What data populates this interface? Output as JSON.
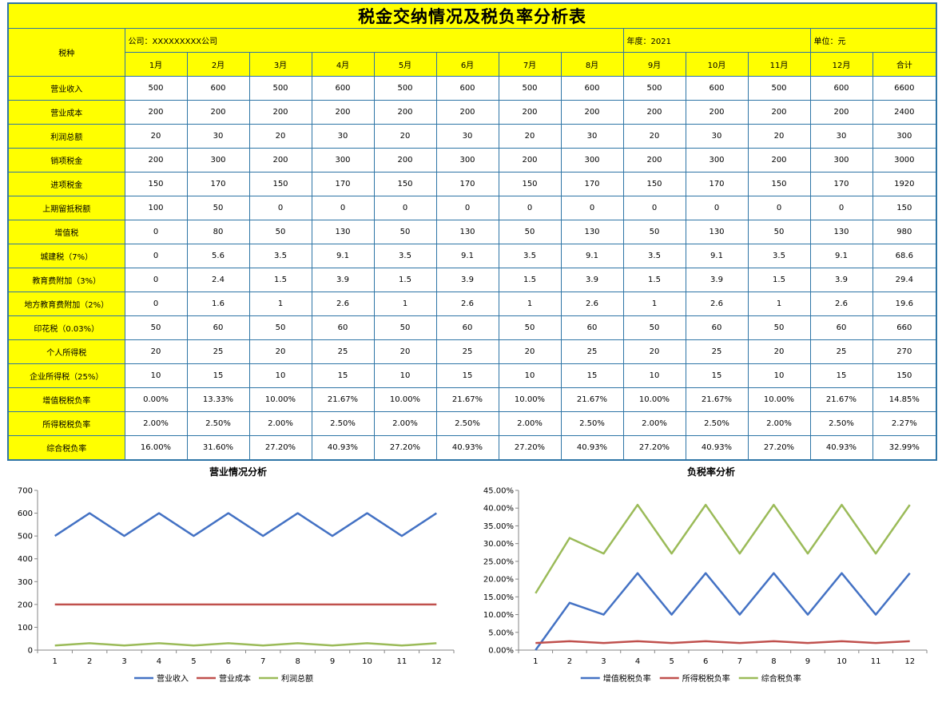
{
  "title": "税金交纳情况及税负率分析表",
  "header": {
    "tax_type": "税种",
    "company": "公司：XXXXXXXXX公司",
    "year": "年度：2021",
    "unit": "单位：元",
    "months": [
      "1月",
      "2月",
      "3月",
      "4月",
      "5月",
      "6月",
      "7月",
      "8月",
      "9月",
      "10月",
      "11月",
      "12月"
    ],
    "total": "合计"
  },
  "rows": [
    {
      "label": "营业收入",
      "values": [
        "500",
        "600",
        "500",
        "600",
        "500",
        "600",
        "500",
        "600",
        "500",
        "600",
        "500",
        "600",
        "6600"
      ]
    },
    {
      "label": "营业成本",
      "values": [
        "200",
        "200",
        "200",
        "200",
        "200",
        "200",
        "200",
        "200",
        "200",
        "200",
        "200",
        "200",
        "2400"
      ]
    },
    {
      "label": "利润总额",
      "values": [
        "20",
        "30",
        "20",
        "30",
        "20",
        "30",
        "20",
        "30",
        "20",
        "30",
        "20",
        "30",
        "300"
      ]
    },
    {
      "label": "销项税金",
      "values": [
        "200",
        "300",
        "200",
        "300",
        "200",
        "300",
        "200",
        "300",
        "200",
        "300",
        "200",
        "300",
        "3000"
      ]
    },
    {
      "label": "进项税金",
      "values": [
        "150",
        "170",
        "150",
        "170",
        "150",
        "170",
        "150",
        "170",
        "150",
        "170",
        "150",
        "170",
        "1920"
      ]
    },
    {
      "label": "上期留抵税额",
      "values": [
        "100",
        "50",
        "0",
        "0",
        "0",
        "0",
        "0",
        "0",
        "0",
        "0",
        "0",
        "0",
        "150"
      ]
    },
    {
      "label": "增值税",
      "values": [
        "0",
        "80",
        "50",
        "130",
        "50",
        "130",
        "50",
        "130",
        "50",
        "130",
        "50",
        "130",
        "980"
      ]
    },
    {
      "label": "城建税（7%）",
      "values": [
        "0",
        "5.6",
        "3.5",
        "9.1",
        "3.5",
        "9.1",
        "3.5",
        "9.1",
        "3.5",
        "9.1",
        "3.5",
        "9.1",
        "68.6"
      ]
    },
    {
      "label": "教育费附加（3%）",
      "values": [
        "0",
        "2.4",
        "1.5",
        "3.9",
        "1.5",
        "3.9",
        "1.5",
        "3.9",
        "1.5",
        "3.9",
        "1.5",
        "3.9",
        "29.4"
      ]
    },
    {
      "label": "地方教育费附加（2%）",
      "values": [
        "0",
        "1.6",
        "1",
        "2.6",
        "1",
        "2.6",
        "1",
        "2.6",
        "1",
        "2.6",
        "1",
        "2.6",
        "19.6"
      ]
    },
    {
      "label": "印花税（0.03%）",
      "values": [
        "50",
        "60",
        "50",
        "60",
        "50",
        "60",
        "50",
        "60",
        "50",
        "60",
        "50",
        "60",
        "660"
      ]
    },
    {
      "label": "个人所得税",
      "values": [
        "20",
        "25",
        "20",
        "25",
        "20",
        "25",
        "20",
        "25",
        "20",
        "25",
        "20",
        "25",
        "270"
      ]
    },
    {
      "label": "企业所得税（25%）",
      "values": [
        "10",
        "15",
        "10",
        "15",
        "10",
        "15",
        "10",
        "15",
        "10",
        "15",
        "10",
        "15",
        "150"
      ]
    },
    {
      "label": "增值税税负率",
      "values": [
        "0.00%",
        "13.33%",
        "10.00%",
        "21.67%",
        "10.00%",
        "21.67%",
        "10.00%",
        "21.67%",
        "10.00%",
        "21.67%",
        "10.00%",
        "21.67%",
        "14.85%"
      ]
    },
    {
      "label": "所得税税负率",
      "values": [
        "2.00%",
        "2.50%",
        "2.00%",
        "2.50%",
        "2.00%",
        "2.50%",
        "2.00%",
        "2.50%",
        "2.00%",
        "2.50%",
        "2.00%",
        "2.50%",
        "2.27%"
      ]
    },
    {
      "label": "综合税负率",
      "values": [
        "16.00%",
        "31.60%",
        "27.20%",
        "40.93%",
        "27.20%",
        "40.93%",
        "27.20%",
        "40.93%",
        "27.20%",
        "40.93%",
        "27.20%",
        "40.93%",
        "32.99%"
      ]
    }
  ],
  "chart_data": [
    {
      "type": "line",
      "title": "营业情况分析",
      "categories": [
        "1",
        "2",
        "3",
        "4",
        "5",
        "6",
        "7",
        "8",
        "9",
        "10",
        "11",
        "12"
      ],
      "ylim": [
        0,
        700
      ],
      "yticks": [
        "0",
        "100",
        "200",
        "300",
        "400",
        "500",
        "600",
        "700"
      ],
      "grid": false,
      "legend": "bottom",
      "series": [
        {
          "name": "营业收入",
          "color": "#4472c4",
          "values": [
            500,
            600,
            500,
            600,
            500,
            600,
            500,
            600,
            500,
            600,
            500,
            600
          ]
        },
        {
          "name": "营业成本",
          "color": "#c0504d",
          "values": [
            200,
            200,
            200,
            200,
            200,
            200,
            200,
            200,
            200,
            200,
            200,
            200
          ]
        },
        {
          "name": "利润总额",
          "color": "#9bbb59",
          "values": [
            20,
            30,
            20,
            30,
            20,
            30,
            20,
            30,
            20,
            30,
            20,
            30
          ]
        }
      ]
    },
    {
      "type": "line",
      "title": "负税率分析",
      "categories": [
        "1",
        "2",
        "3",
        "4",
        "5",
        "6",
        "7",
        "8",
        "9",
        "10",
        "11",
        "12"
      ],
      "ylim": [
        0,
        45
      ],
      "yticks": [
        "0.00%",
        "5.00%",
        "10.00%",
        "15.00%",
        "20.00%",
        "25.00%",
        "30.00%",
        "35.00%",
        "40.00%",
        "45.00%"
      ],
      "grid": false,
      "legend": "bottom",
      "series": [
        {
          "name": "增值税税负率",
          "color": "#4472c4",
          "values": [
            0,
            13.33,
            10,
            21.67,
            10,
            21.67,
            10,
            21.67,
            10,
            21.67,
            10,
            21.67
          ]
        },
        {
          "name": "所得税税负率",
          "color": "#c0504d",
          "values": [
            2,
            2.5,
            2,
            2.5,
            2,
            2.5,
            2,
            2.5,
            2,
            2.5,
            2,
            2.5
          ]
        },
        {
          "name": "综合税负率",
          "color": "#9bbb59",
          "values": [
            16,
            31.6,
            27.2,
            40.93,
            27.2,
            40.93,
            27.2,
            40.93,
            27.2,
            40.93,
            27.2,
            40.93
          ]
        }
      ]
    }
  ]
}
